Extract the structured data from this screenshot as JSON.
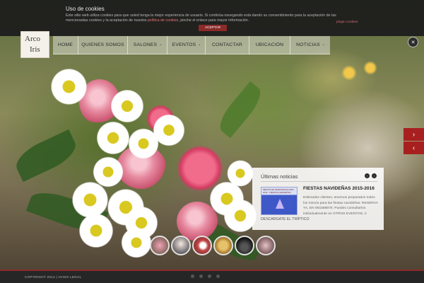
{
  "cookie": {
    "title": "Uso de cookies",
    "text": "Este sitio web utiliza cookies para que usted tenga la mejor experiencia de usuario. Si continúa navegando está dando su consentimiento para la aceptación de las mencionadas cookies y la aceptación de nuestra",
    "link": "política de cookies",
    "text_end": ", pinche el enlace para mayor información.",
    "accept_label": "ACEPTAR",
    "plugin_label": "plugin cookies"
  },
  "logo": {
    "line1": "Arco",
    "line2": "Iris"
  },
  "nav": {
    "items": [
      {
        "label": "HOME",
        "has_dropdown": false
      },
      {
        "label": "QUIENES SOMOS",
        "has_dropdown": false
      },
      {
        "label": "SALONES",
        "has_dropdown": true
      },
      {
        "label": "EVENTOS",
        "has_dropdown": true
      },
      {
        "label": "CONTACTAR",
        "has_dropdown": false
      },
      {
        "label": "UBICACIÓN",
        "has_dropdown": false
      },
      {
        "label": "NOTICIAS",
        "has_dropdown": true
      }
    ],
    "dropdown_marker": "•"
  },
  "controls": {
    "close_glyph": "✕",
    "next_glyph": "›",
    "prev_glyph": "‹",
    "news_prev_glyph": "‹",
    "news_next_glyph": "›"
  },
  "news": {
    "heading": "Últimas noticias",
    "thumb_text": "MENÚS DE TEMPORADA 2015-2016 · FIESTAS NAVIDEÑAS",
    "caption": "DESCARGATE EL TRÍPTICO",
    "title": "FIESTAS NAVIDEÑAS 2015-2016",
    "excerpt": "Estimados clientes, tenemos preparados todos los menús para las fiestas navideñas: RESERVA YA, EN 961588870. Puedes consultarlos individualmente en OTROS EVENTOS, ó"
  },
  "thumbnails": [
    "thumb-1",
    "thumb-2",
    "thumb-3",
    "thumb-4",
    "thumb-5",
    "thumb-6"
  ],
  "footer": {
    "text": "COPYRIGHT 2014 | AVISO LEGAL"
  },
  "colors": {
    "accent": "#a7201f",
    "cookie_link": "#e8727a",
    "footer_bg": "#262626"
  }
}
